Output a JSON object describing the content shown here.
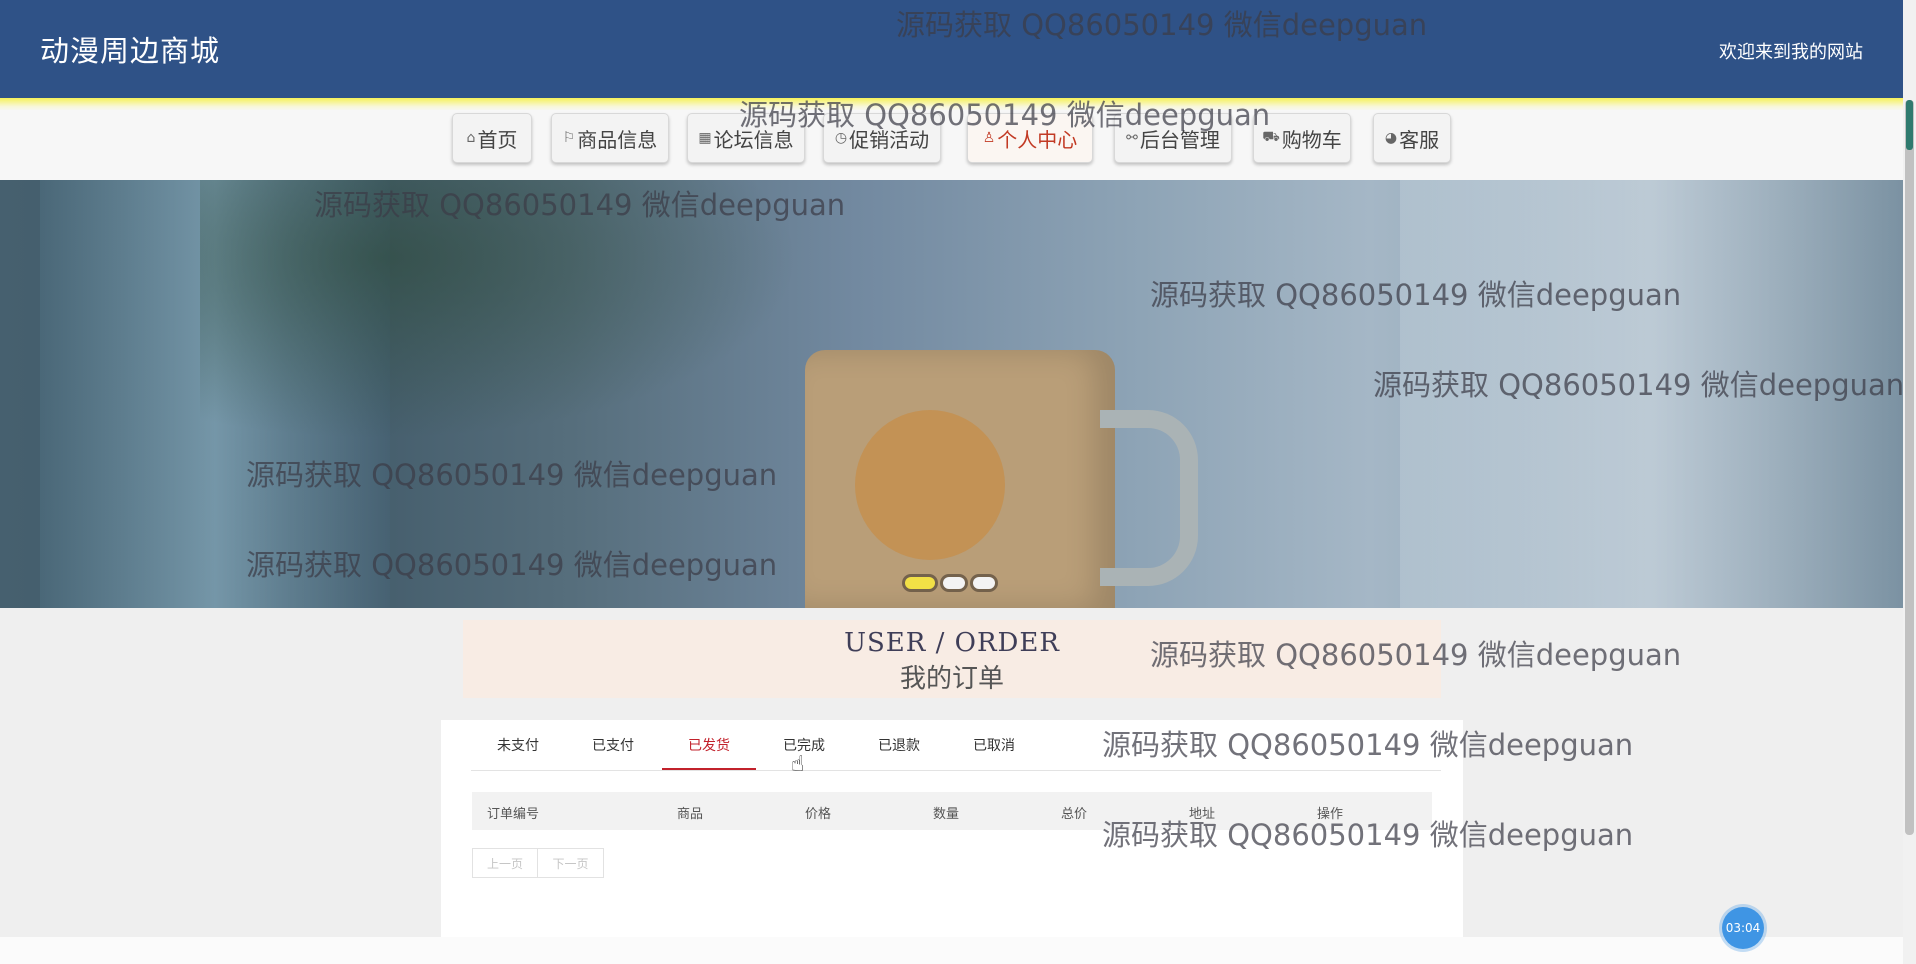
{
  "header": {
    "title": "动漫周边商城",
    "welcome": "欢迎来到我的网站",
    "colors": {
      "bar": "#2f5287",
      "accent": "#f6f15a"
    }
  },
  "nav": {
    "items": [
      {
        "icon": "home-icon",
        "glyph": "⌂",
        "label": "首页"
      },
      {
        "icon": "flag-icon",
        "glyph": "⚐",
        "label": "商品信息"
      },
      {
        "icon": "forum-icon",
        "glyph": "▦",
        "label": "论坛信息"
      },
      {
        "icon": "clock-icon",
        "glyph": "◷",
        "label": "促销活动"
      },
      {
        "icon": "user-icon",
        "glyph": "♙",
        "label": "个人中心"
      },
      {
        "icon": "link-icon",
        "glyph": "⚯",
        "label": "后台管理"
      },
      {
        "icon": "cart-icon",
        "glyph": "⛟",
        "label": "购物车"
      },
      {
        "icon": "chat-icon",
        "glyph": "◕",
        "label": "客服"
      }
    ],
    "active": "个人中心"
  },
  "banner": {
    "slides": 3,
    "active_slide": 1
  },
  "order": {
    "title_en": "USER / ORDER",
    "title_cn": "我的订单",
    "tabs": [
      "未支付",
      "已支付",
      "已发货",
      "已完成",
      "已退款",
      "已取消"
    ],
    "active_tab": "已发货",
    "columns": [
      "订单编号",
      "商品",
      "价格",
      "数量",
      "总价",
      "地址",
      "操作"
    ],
    "pager": {
      "prev": "上一页",
      "next": "下一页"
    }
  },
  "timer": "03:04",
  "watermark": "源码获取 QQ86050149 微信deepguan"
}
